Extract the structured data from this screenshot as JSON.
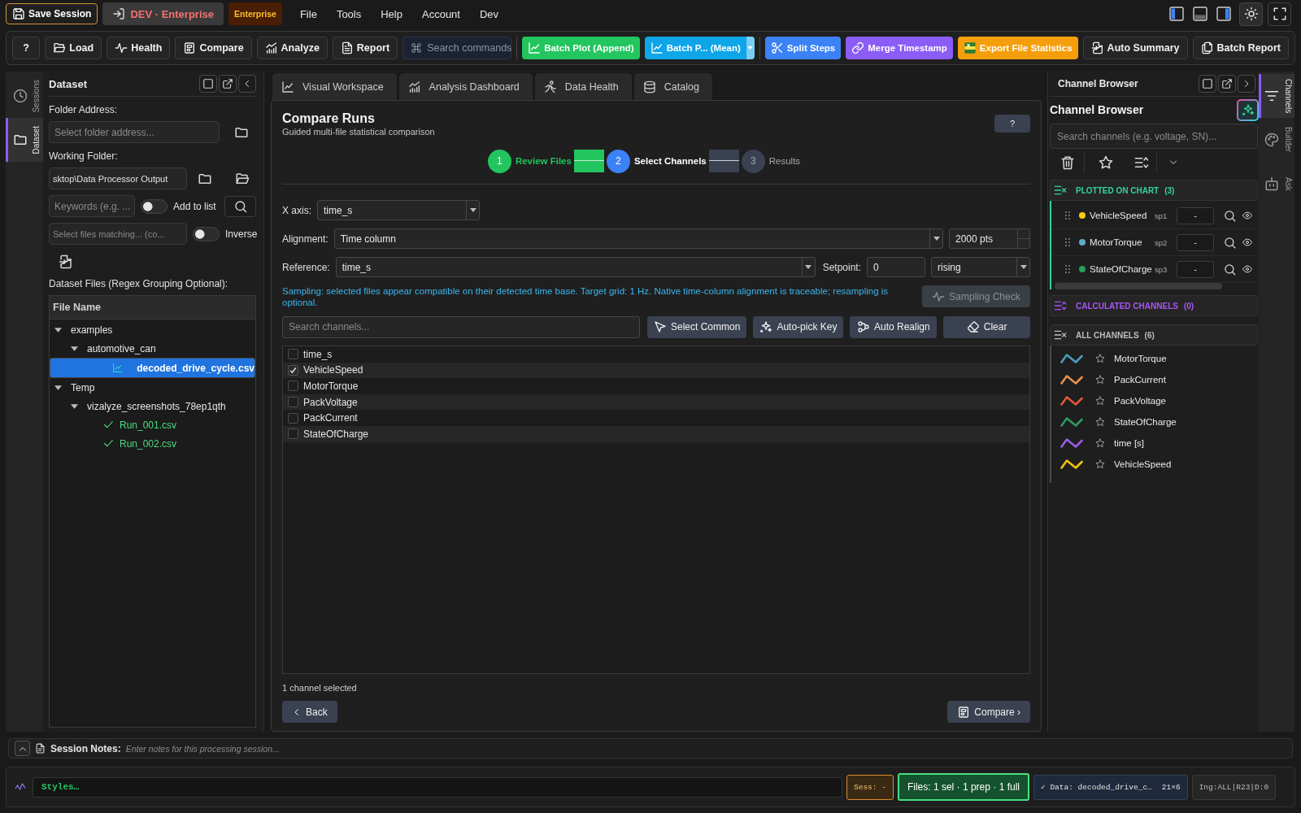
{
  "menubar": {
    "save_session": "Save Session",
    "profile": "DEV · Enterprise",
    "edition": "Enterprise",
    "menus": [
      "File",
      "Tools",
      "Help",
      "Account",
      "Dev"
    ],
    "layout_toggles": [
      {
        "kind": "left",
        "on": true
      },
      {
        "kind": "bottom",
        "on": false
      },
      {
        "kind": "right",
        "on": true
      }
    ]
  },
  "toolbar": {
    "items": [
      {
        "kind": "button",
        "label": "?"
      },
      {
        "kind": "button",
        "label": "Load"
      },
      {
        "kind": "button",
        "label": "Health"
      },
      {
        "kind": "button",
        "label": "Compare"
      },
      {
        "kind": "button",
        "label": "Analyze"
      },
      {
        "kind": "button",
        "label": "Report"
      },
      {
        "kind": "search",
        "placeholder": "Search commands"
      },
      {
        "kind": "accent",
        "label": "Batch Plot (Append)",
        "color": "#22c55e"
      },
      {
        "kind": "split",
        "label": "Batch P... (Mean)",
        "color": "#0ea5e9"
      },
      {
        "kind": "accent",
        "label": "Split Steps",
        "color": "#3b82f6"
      },
      {
        "kind": "accent",
        "label": "Merge Timestamp",
        "color": "#8b5cf6"
      },
      {
        "kind": "accent",
        "label": "Export File Statistics",
        "color": "#f59e0b"
      },
      {
        "kind": "button",
        "label": "Auto Summary"
      },
      {
        "kind": "button",
        "label": "Batch Report"
      }
    ]
  },
  "left_activity": [
    {
      "label": "Sessions",
      "selected": false
    },
    {
      "label": "Dataset",
      "selected": true
    }
  ],
  "dataset_panel": {
    "title": "Dataset",
    "folder_address": {
      "label": "Folder Address:",
      "placeholder": "Select folder address..."
    },
    "working_folder": {
      "label": "Working Folder:",
      "value": "sktop\\Data Processor Output"
    },
    "keywords": {
      "placeholder": "Keywords (e.g. ...",
      "toggle_label": "Add to list",
      "on": false
    },
    "file_filter": {
      "placeholder": "Select files matching... (co...",
      "toggle_label": "Inverse",
      "on": false
    },
    "files_label": "Dataset Files (Regex Grouping Optional):",
    "file_tree": {
      "header": "File Name",
      "items": [
        {
          "label": "examples",
          "kind": "folder",
          "expanded": true,
          "selected": false,
          "children": [
            {
              "label": "automotive_can",
              "kind": "folder",
              "expanded": true,
              "selected": false,
              "children": [
                {
                  "label": "decoded_drive_cycle.csv",
                  "kind": "chart_file",
                  "selected": true
                }
              ]
            }
          ]
        },
        {
          "label": "Temp",
          "kind": "folder",
          "expanded": true,
          "selected": false,
          "children": [
            {
              "label": "vizalyze_screenshots_78ep1qth",
              "kind": "folder",
              "expanded": true,
              "selected": false,
              "children": [
                {
                  "label": "Run_001.csv",
                  "kind": "checked_file",
                  "selected": false
                },
                {
                  "label": "Run_002.csv",
                  "kind": "checked_file",
                  "selected": false
                }
              ]
            }
          ]
        }
      ]
    }
  },
  "tabs": [
    {
      "label": "Visual Workspace",
      "selected": false
    },
    {
      "label": "Analysis Dashboard",
      "selected": false
    },
    {
      "label": "Data Health",
      "selected": false
    },
    {
      "label": "Catalog",
      "selected": false
    }
  ],
  "compare": {
    "title": "Compare Runs",
    "subtitle": "Guided multi-file statistical comparison",
    "help": "?",
    "steps": [
      {
        "number": "1",
        "label": "Review Files",
        "completed": true,
        "active": false
      },
      {
        "number": "2",
        "label": "Select Channels",
        "completed": false,
        "active": true
      },
      {
        "number": "3",
        "label": "Results",
        "completed": false,
        "active": false
      }
    ],
    "x_axis": {
      "label": "X axis:",
      "value": "time_s"
    },
    "alignment": {
      "label": "Alignment:",
      "value": "Time column",
      "points": "2000 pts"
    },
    "reference": {
      "label": "Reference:",
      "value": "time_s",
      "setpoint_label": "Setpoint:",
      "setpoint": "0",
      "edge": "rising"
    },
    "sampling": {
      "note": "Sampling: selected files appear compatible on their detected time base. Target grid: 1 Hz. Native time-column alignment is traceable; resampling is optional.",
      "check": "Sampling Check",
      "check_disabled": true
    },
    "channel_search": {
      "placeholder": "Search channels..."
    },
    "actions": [
      "Select Common",
      "Auto-pick Key",
      "Auto Realign",
      "Clear"
    ],
    "channels": [
      {
        "name": "time_s",
        "checked": false
      },
      {
        "name": "VehicleSpeed",
        "checked": true
      },
      {
        "name": "MotorTorque",
        "checked": false
      },
      {
        "name": "PackVoltage",
        "checked": false
      },
      {
        "name": "PackCurrent",
        "checked": false
      },
      {
        "name": "StateOfCharge",
        "checked": false
      }
    ],
    "selection_count": "1 channel selected",
    "back": "Back",
    "next": "Compare ›"
  },
  "channel_browser": {
    "header": "Channel Browser",
    "title": "Channel Browser",
    "search": {
      "placeholder": "Search channels (e.g. voltage, SN)..."
    },
    "sections": [
      {
        "kind": "plotted",
        "title": "PLOTTED ON CHART",
        "count": "(3)",
        "items": [
          {
            "name": "VehicleSpeed",
            "color": "#facc15",
            "axis": "sp1",
            "value": "-"
          },
          {
            "name": "MotorTorque",
            "color": "#5fa8c8",
            "axis": "sp2",
            "value": "-"
          },
          {
            "name": "StateOfCharge",
            "color": "#22a05a",
            "axis": "sp3",
            "value": "-"
          }
        ]
      },
      {
        "kind": "calculated",
        "title": "CALCULATED CHANNELS",
        "count": "(0)"
      },
      {
        "kind": "all",
        "title": "ALL CHANNELS",
        "count": "(6)",
        "items": [
          {
            "name": "MotorTorque",
            "color": "#4a9fc0",
            "starred": false
          },
          {
            "name": "PackCurrent",
            "color": "#e8914a",
            "starred": false
          },
          {
            "name": "PackVoltage",
            "color": "#e0583a",
            "starred": false
          },
          {
            "name": "StateOfCharge",
            "color": "#2e9a5e",
            "starred": false
          },
          {
            "name": "time [s]",
            "color": "#9b5de5",
            "starred": false
          },
          {
            "name": "VehicleSpeed",
            "color": "#f2c40f",
            "starred": false
          }
        ]
      }
    ]
  },
  "right_activity": [
    {
      "label": "Channels",
      "selected": true
    },
    {
      "label": "Builder",
      "selected": false
    },
    {
      "label": "Ask",
      "selected": false
    }
  ],
  "session_notes": {
    "label": "Session Notes:",
    "placeholder": "Enter notes for this processing session..."
  },
  "status_bar": {
    "console": {
      "value": "Styles…"
    },
    "session": "Sess: -",
    "files": "Files: 1 sel · 1 prep · 1 full",
    "data_file": "✓ Data: decoded_drive_c…",
    "data_shape": "21×6",
    "engine": "Ing:ALL|R23|D:0"
  }
}
